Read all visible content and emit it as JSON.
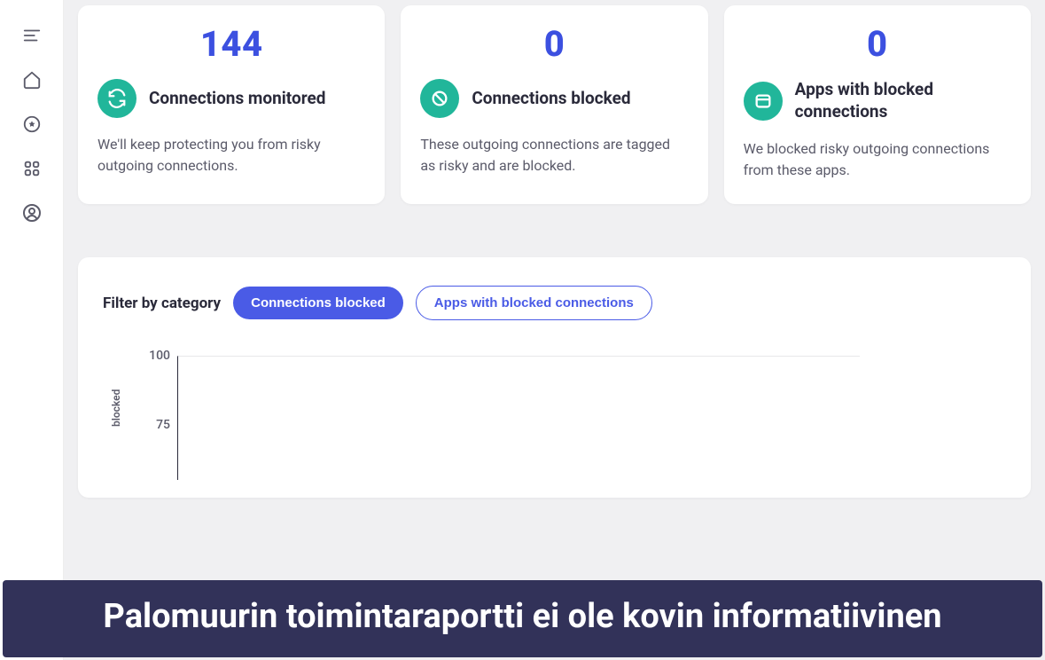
{
  "sidebar": {
    "items": [
      {
        "name": "menu"
      },
      {
        "name": "home"
      },
      {
        "name": "favorites"
      },
      {
        "name": "apps"
      },
      {
        "name": "profile"
      }
    ]
  },
  "stats": [
    {
      "number": "144",
      "title": "Connections monitored",
      "desc": "We'll keep protecting you from risky outgoing connections."
    },
    {
      "number": "0",
      "title": "Connections blocked",
      "desc": "These outgoing connections are tagged as risky and are blocked."
    },
    {
      "number": "0",
      "title": "Apps with blocked connections",
      "desc": "We blocked risky outgoing connections from these apps."
    }
  ],
  "filter": {
    "label": "Filter by category",
    "options": [
      "Connections blocked",
      "Apps with blocked connections"
    ],
    "active": 0
  },
  "banner": "Palomuurin toimintaraportti ei ole kovin informatiivinen",
  "chart_data": {
    "type": "bar",
    "ylabel": "blocked",
    "ylim": [
      0,
      100
    ],
    "y_ticks": [
      100,
      75
    ],
    "categories": [],
    "values": []
  }
}
